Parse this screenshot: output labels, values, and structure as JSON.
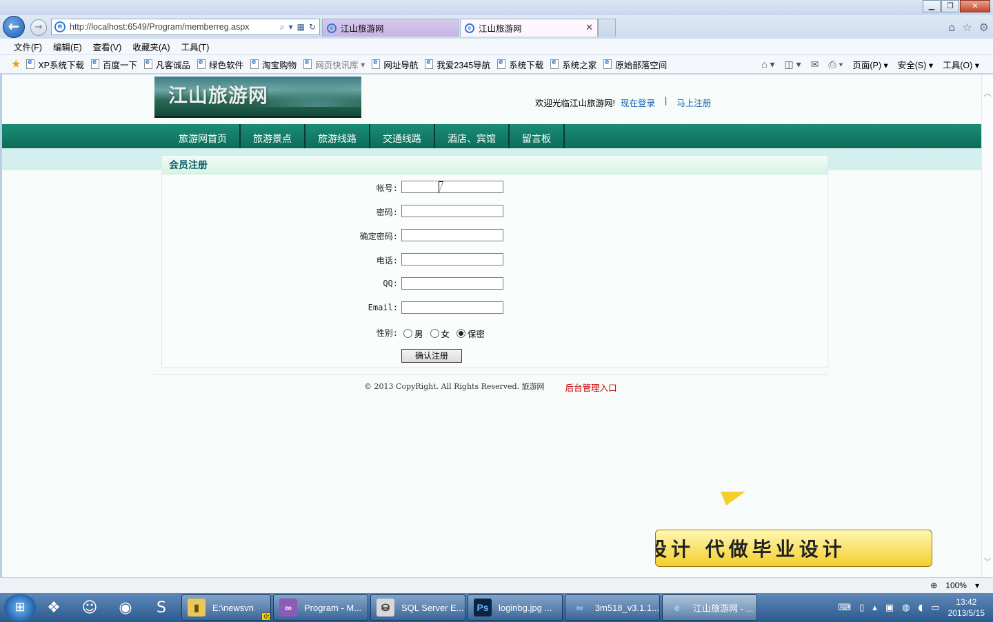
{
  "browser": {
    "url": "http://localhost:6549/Program/memberreg.aspx",
    "tabs": [
      {
        "label": "江山旅游网"
      },
      {
        "label": "江山旅游网"
      }
    ],
    "menu": [
      "文件(F)",
      "编辑(E)",
      "查看(V)",
      "收藏夹(A)",
      "工具(T)"
    ],
    "favorites": [
      "XP系统下载",
      "百度一下",
      "凡客诚品",
      "绿色软件",
      "淘宝购物",
      "网页快讯库",
      "网址导航",
      "我爱2345导航",
      "系统下载",
      "系统之家",
      "原始部落空间"
    ],
    "commands": {
      "page": "页面(P)",
      "safety": "安全(S)",
      "tools": "工具(O)"
    },
    "zoom": "100%"
  },
  "site": {
    "logo_text": "江山旅游网",
    "welcome": "欢迎光临江山旅游网!",
    "login_link": "现在登录",
    "separator": "|",
    "register_link": "马上注册",
    "nav": [
      "旅游网首页",
      "旅游景点",
      "旅游线路",
      "交通线路",
      "酒店、宾馆",
      "留言板"
    ]
  },
  "form": {
    "title": "会员注册",
    "fields": [
      {
        "label": "帐号:",
        "value": ""
      },
      {
        "label": "密码:",
        "value": ""
      },
      {
        "label": "确定密码:",
        "value": ""
      },
      {
        "label": "电话:",
        "value": ""
      },
      {
        "label": "QQ:",
        "value": ""
      },
      {
        "label": "Email:",
        "value": ""
      }
    ],
    "gender_label": "性别:",
    "gender_options": [
      "男",
      "女",
      "保密"
    ],
    "gender_selected": "保密",
    "submit": "确认注册"
  },
  "footer": {
    "copyright": "© 2013 CopyRight. All Rights Reserved. 旅游网",
    "admin_link": "后台管理入口"
  },
  "overlay": {
    "callout_text": "设计 代做毕业设计"
  },
  "taskbar": {
    "tasks": [
      {
        "label": "E:\\newsvn",
        "badge": "0:32"
      },
      {
        "label": "Program - M..."
      },
      {
        "label": "SQL Server E..."
      },
      {
        "label": "loginbg.jpg ..."
      },
      {
        "label": "3m518_v3.1.1..."
      },
      {
        "label": "江山旅游网 - ..."
      }
    ],
    "time": "13:42",
    "date": "2013/5/15"
  },
  "colors": {
    "nav_green": "#0e6c59",
    "panel_title": "#0c5e6d",
    "link_blue": "#1565b0",
    "admin_red": "#cc0000"
  }
}
